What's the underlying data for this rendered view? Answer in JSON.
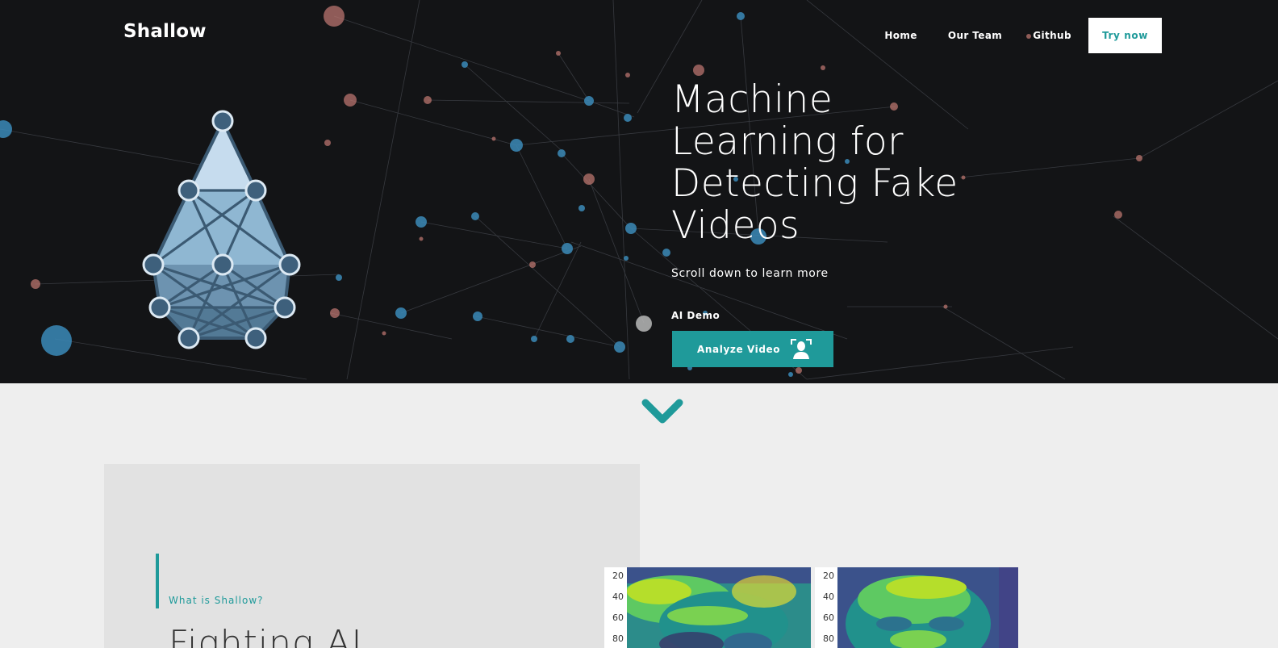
{
  "header": {
    "brand": "Shallow",
    "nav": [
      {
        "label": "Home"
      },
      {
        "label": "Our Team"
      },
      {
        "label": "Github"
      }
    ],
    "cta_label": "Try now"
  },
  "hero": {
    "title": "Machine Learning for Detecting Fake Videos",
    "subtitle": "Scroll down to learn more",
    "demo_label": "AI Demo",
    "analyze_label": "Analyze Video"
  },
  "about": {
    "eyebrow": "What is Shallow?",
    "heading": "Fighting AI"
  },
  "heatmaps": [
    {
      "ticks": [
        "20",
        "40",
        "60",
        "80"
      ]
    },
    {
      "ticks": [
        "20",
        "40",
        "60",
        "80"
      ]
    }
  ],
  "colors": {
    "accent": "#1f9a9a",
    "hero_bg": "#131416",
    "page_bg": "#eeeeee",
    "card_bg": "#e2e2e2"
  },
  "icons": [
    "face-scan-icon",
    "chevron-down-icon",
    "network-logo-icon"
  ]
}
